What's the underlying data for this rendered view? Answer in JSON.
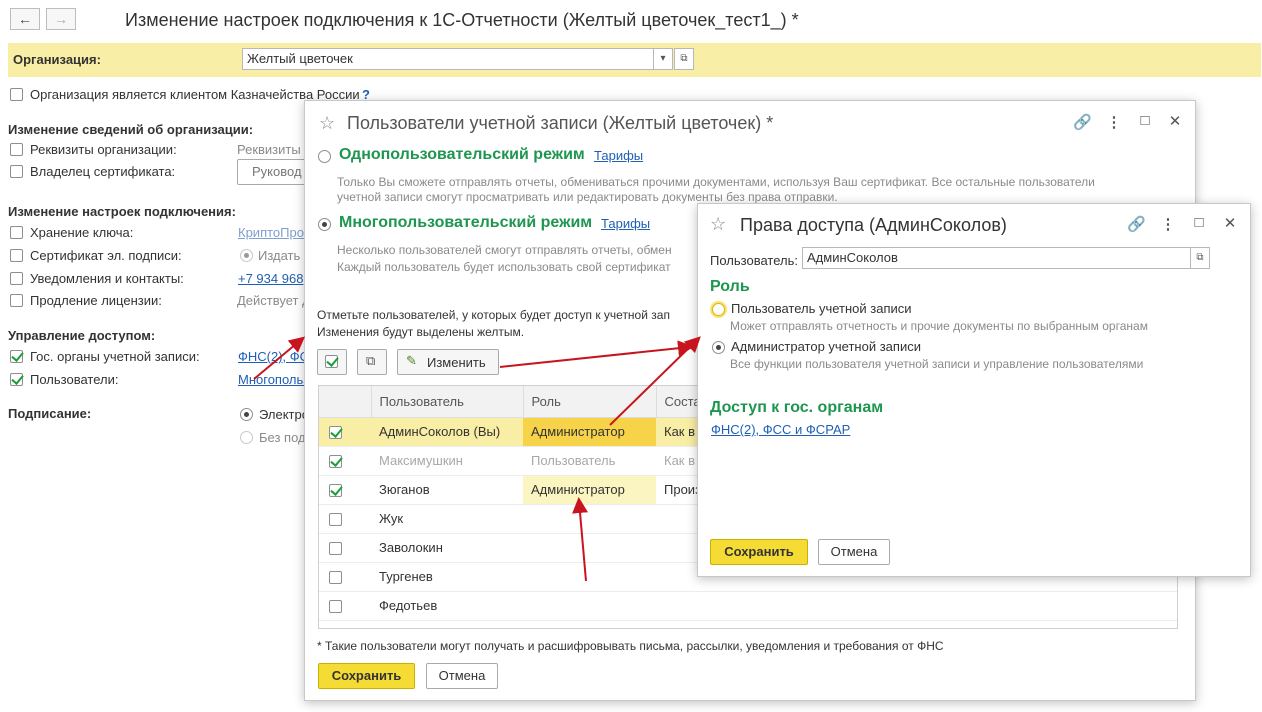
{
  "main": {
    "title": "Изменение настроек подключения к 1С-Отчетности (Желтый цветочек_тест1_) *",
    "org_label": "Организация:",
    "org_value": "Желтый цветочек",
    "treasury_label": "Организация является клиентом Казначейства России",
    "treasury_help": "?",
    "sec_org_changes": "Изменение сведений об организации:",
    "requisites_label": "Реквизиты организации:",
    "requisites_value": "Реквизиты",
    "cert_owner_label": "Владелец сертификата:",
    "cert_owner_button": "Руковод",
    "sec_conn": "Изменение настроек подключения:",
    "key_storage_label": "Хранение ключа:",
    "key_storage_value": "КриптоПро",
    "sig_cert_label": "Сертификат эл. подписи:",
    "sig_cert_value": "Издать",
    "notif_label": "Уведомления и контакты:",
    "notif_value": "+7 934 968",
    "license_label": "Продление лицензии:",
    "license_value": "Действует д",
    "sec_access": "Управление доступом:",
    "gov_label": "Гос. органы учетной записи:",
    "gov_value": "ФНС(2), ФС",
    "users_label": "Пользователи:",
    "users_value": "Многопольз",
    "sign_label": "Подписание:",
    "sign_opt1": "Электро",
    "sign_opt2": "Без под"
  },
  "users_dialog": {
    "title": "Пользователи учетной записи (Желтый цветочек) *",
    "single_mode": "Однопользовательский режим",
    "tariffs": "Тарифы",
    "single_desc1": "Только Вы сможете отправлять отчеты, обмениваться прочими документами, используя Ваш сертификат. Все остальные пользователи",
    "single_desc2": "учетной записи смогут просматривать или редактировать документы без права отправки.",
    "multi_mode": "Многопользовательский режим",
    "multi_desc1": "Несколько пользователей смогут отправлять отчеты, обмен",
    "multi_desc2": "Каждый пользователь будет использовать свой сертификат",
    "note1": "Отметьте пользователей, у которых будет доступ к учетной зап",
    "note2": "Изменения будут выделены желтым.",
    "edit_button": "Изменить",
    "columns": [
      "Пользователь",
      "Роль",
      "Соста"
    ],
    "rows": [
      {
        "checked": true,
        "user": "АдминСоколов (Вы)",
        "role": "Администратор",
        "comp": "Как в"
      },
      {
        "checked": true,
        "user": "Максимушкин",
        "role": "Пользователь",
        "comp": "Как в"
      },
      {
        "checked": true,
        "user": "Зюганов",
        "role": "Администратор",
        "comp": "Произ"
      },
      {
        "checked": false,
        "user": "Жук",
        "role": "",
        "comp": ""
      },
      {
        "checked": false,
        "user": "Заволокин",
        "role": "",
        "comp": ""
      },
      {
        "checked": false,
        "user": "Тургенев",
        "role": "",
        "comp": ""
      },
      {
        "checked": false,
        "user": "Федотьев",
        "role": "",
        "comp": ""
      }
    ],
    "footnote": "* Такие пользователи могут получать и расшифровывать письма, рассылки, уведомления и требования от ФНС",
    "save": "Сохранить",
    "cancel": "Отмена"
  },
  "rights_dialog": {
    "title": "Права доступа (АдминСоколов)",
    "user_label": "Пользователь:",
    "user_value": "АдминСоколов",
    "role_heading": "Роль",
    "role_user": "Пользователь учетной записи",
    "role_user_desc": "Может отправлять отчетность и прочие документы по выбранным органам",
    "role_admin": "Администратор учетной записи",
    "role_admin_desc": "Все функции пользователя учетной записи и управление пользователями",
    "gov_heading": "Доступ к гос. органам",
    "gov_link": "ФНС(2), ФСС и ФСРАР",
    "save": "Сохранить",
    "cancel": "Отмена"
  },
  "colors": {
    "highlight_yellow": "#f9eea5",
    "button_yellow": "#f5dc34",
    "heading_green": "#1e9650",
    "link_blue": "#1f5fb4",
    "arrow_red": "#c8141e"
  }
}
